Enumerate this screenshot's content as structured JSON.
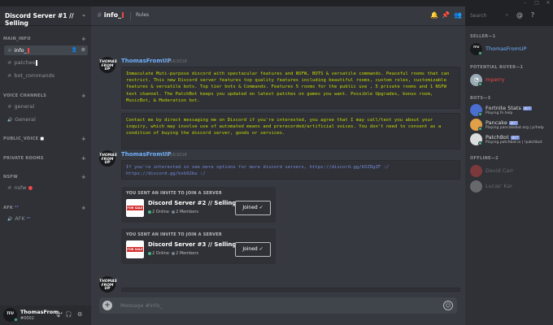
{
  "window": {
    "minimize": "–",
    "maximize": "□",
    "close": "✕"
  },
  "server": {
    "name": "Discord Server #1 // Selling",
    "chevron": "⌄"
  },
  "sidebar": {
    "categories": [
      {
        "label": "MAIN_INFO",
        "plus": "+"
      },
      {
        "label": "VOICE CHANNELS",
        "plus": "+"
      },
      {
        "label": "PUBLIC_VOICE",
        "plus": "+"
      },
      {
        "label": "PRIVATE ROOMS",
        "plus": "+"
      },
      {
        "label": "NSFW",
        "plus": "+"
      },
      {
        "label": "AFK",
        "plus": "+"
      }
    ],
    "channels": [
      {
        "label": "info_",
        "hash": "#"
      },
      {
        "label": "patches",
        "hash": "#"
      },
      {
        "label": "bot_commands",
        "hash": "#"
      },
      {
        "label": "general",
        "hash": "#"
      },
      {
        "label": "General",
        "hash": "🔊"
      },
      {
        "label": "nsfw",
        "hash": "#"
      },
      {
        "label": "AFK",
        "hash": "🔊"
      }
    ]
  },
  "user_panel": {
    "name": "ThomasFrom..",
    "tag": "#0002",
    "mic": "🎙",
    "headset": "🎧",
    "settings": "⚙"
  },
  "header": {
    "channel": "info_",
    "hash": "#",
    "topic": "Rules",
    "search_placeholder": "Search"
  },
  "messages": [
    {
      "author": "ThomasFromUP",
      "timestamp": "07/16/2018",
      "blocks": [
        "Immaculate Muti-purpose discord with spectacular features and NSFW, BOTS & versatile commands. Peaceful rooms that can restrict. This new Discord server features top quality features including beautiful rooms, custom roles, customizable features & versatile bots. Top tier bots & Commands. Features 5 rooms for the public use , 5 private rooms and 1 NSFW text channel. The PatchBot keeps you updated on latest patches on games you want. Possible Upgrades, bonus room, MusicBot, & Moderation bot.",
        "Contact me by direct messaging me on Discord if you're interested, you agree that I may call/text you about your inquiry, which may involve use of automated means and prerecorded/artificial voices. You don't need to consent as a condition of buying the discord server, goods or services."
      ]
    },
    {
      "author": "ThomasFromUP",
      "timestamp": "07/16/2018",
      "link_text": "If you're interested in see more options for more discord servers, https://discord.gg/b5Z8gZF :/ https://discord.gg/kxb92bu :/",
      "invites": [
        {
          "head": "YOU SENT AN INVITE TO JOIN A SERVER",
          "name": "Discord Server #2 // Selling",
          "online": "2 Online",
          "members": "2 Members",
          "button": "Joined",
          "icon_text": "FOR SALE"
        },
        {
          "head": "YOU SENT AN INVITE TO JOIN A SERVER",
          "name": "Discord Server #3 // Selling",
          "online": "2 Online",
          "members": "2 Members",
          "button": "Joined",
          "icon_text": "FOR SALE"
        }
      ]
    },
    {
      "author": "",
      "timestamp": "",
      "blocks": []
    }
  ],
  "composer": {
    "placeholder": "Message #info_",
    "plus": "+",
    "emoji": "☺"
  },
  "members": {
    "groups": [
      {
        "label": "SELLER—1"
      },
      {
        "label": "POTENTIAL BUYER—1"
      },
      {
        "label": "BOTS—3"
      },
      {
        "label": "OFFLINE—2"
      }
    ],
    "list": [
      {
        "name": "ThomasFromUP",
        "sub": "",
        "color": "#6fb0ff",
        "bot": ""
      },
      {
        "name": "mperry",
        "sub": "",
        "color": "#f04747",
        "bot": ""
      },
      {
        "name": "Fortnite Stats",
        "sub": "Playing fn.help",
        "color": "#dcddde",
        "bot": "BOT"
      },
      {
        "name": "Pancake",
        "sub": "Playing pancakebot.org | p!help",
        "color": "#dcddde",
        "bot": "BOT"
      },
      {
        "name": "PatchBot",
        "sub": "Playing patchbot.io | !patchbot",
        "color": "#dcddde",
        "bot": "BOT"
      },
      {
        "name": "David Carr",
        "sub": "",
        "color": "#72767d",
        "bot": ""
      },
      {
        "name": "Lucas' Kar",
        "sub": "",
        "color": "#72767d",
        "bot": ""
      }
    ]
  },
  "colors": {
    "accent": "#7289da",
    "online": "#43b581",
    "dnd": "#f04747",
    "code_text": "#c8d800"
  }
}
